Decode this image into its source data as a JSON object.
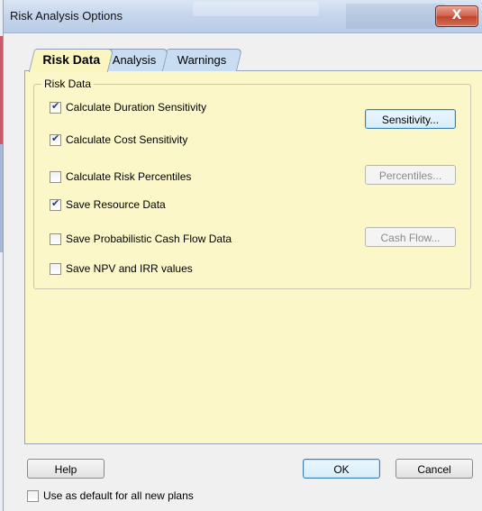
{
  "window": {
    "title": "Risk Analysis Options",
    "close_glyph": "X"
  },
  "tabs": [
    {
      "label": "Risk Data",
      "active": true
    },
    {
      "label": "Analysis",
      "active": false
    },
    {
      "label": "Warnings",
      "active": false
    }
  ],
  "risk_data": {
    "group_label": "Risk Data",
    "options": [
      {
        "label": "Calculate Duration Sensitivity",
        "checked": true
      },
      {
        "label": "Calculate Cost Sensitivity",
        "checked": true
      },
      {
        "label": "Calculate Risk Percentiles",
        "checked": false
      },
      {
        "label": "Save Resource Data",
        "checked": true
      },
      {
        "label": "Save Probabilistic Cash Flow Data",
        "checked": false
      },
      {
        "label": "Save NPV and IRR values",
        "checked": false
      }
    ],
    "buttons": {
      "sensitivity": "Sensitivity...",
      "percentiles": "Percentiles...",
      "cash_flow": "Cash Flow..."
    }
  },
  "footer": {
    "help": "Help",
    "ok": "OK",
    "cancel": "Cancel",
    "default_checkbox": {
      "label": "Use as default for all new plans",
      "checked": false
    }
  },
  "colors": {
    "tab_page": "#fbf7c8",
    "inactive_tab": "#c9ddf2",
    "close_button": "#c8513a"
  }
}
